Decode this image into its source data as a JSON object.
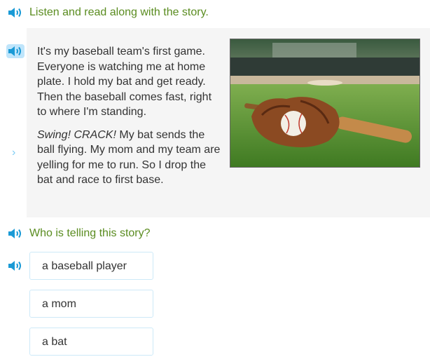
{
  "instruction": {
    "text": "Listen and read along with the story."
  },
  "story": {
    "paragraph1": "It's my baseball team's first game. Everyone is watching me at home plate. I hold my bat and get ready. Then the baseball comes fast, right to where I'm standing.",
    "paragraph2_emphasis": "Swing! CRACK!",
    "paragraph2_rest": " My bat sends the ball flying. My mom and my team are yelling for me to run. So I drop the bat and race to first base."
  },
  "question": {
    "text": "Who is telling this story?"
  },
  "choices": [
    {
      "label": "a baseball player"
    },
    {
      "label": "a mom"
    },
    {
      "label": "a bat"
    }
  ],
  "icons": {
    "speaker": "speaker-icon",
    "chevron": "chevron-right-icon"
  },
  "colors": {
    "prompt_green": "#5a8c20",
    "speaker_blue": "#1a9ad6",
    "speaker_active_bg": "#bfe5fb",
    "story_bg": "#f5f5f5",
    "choice_border": "#cde9f8"
  }
}
